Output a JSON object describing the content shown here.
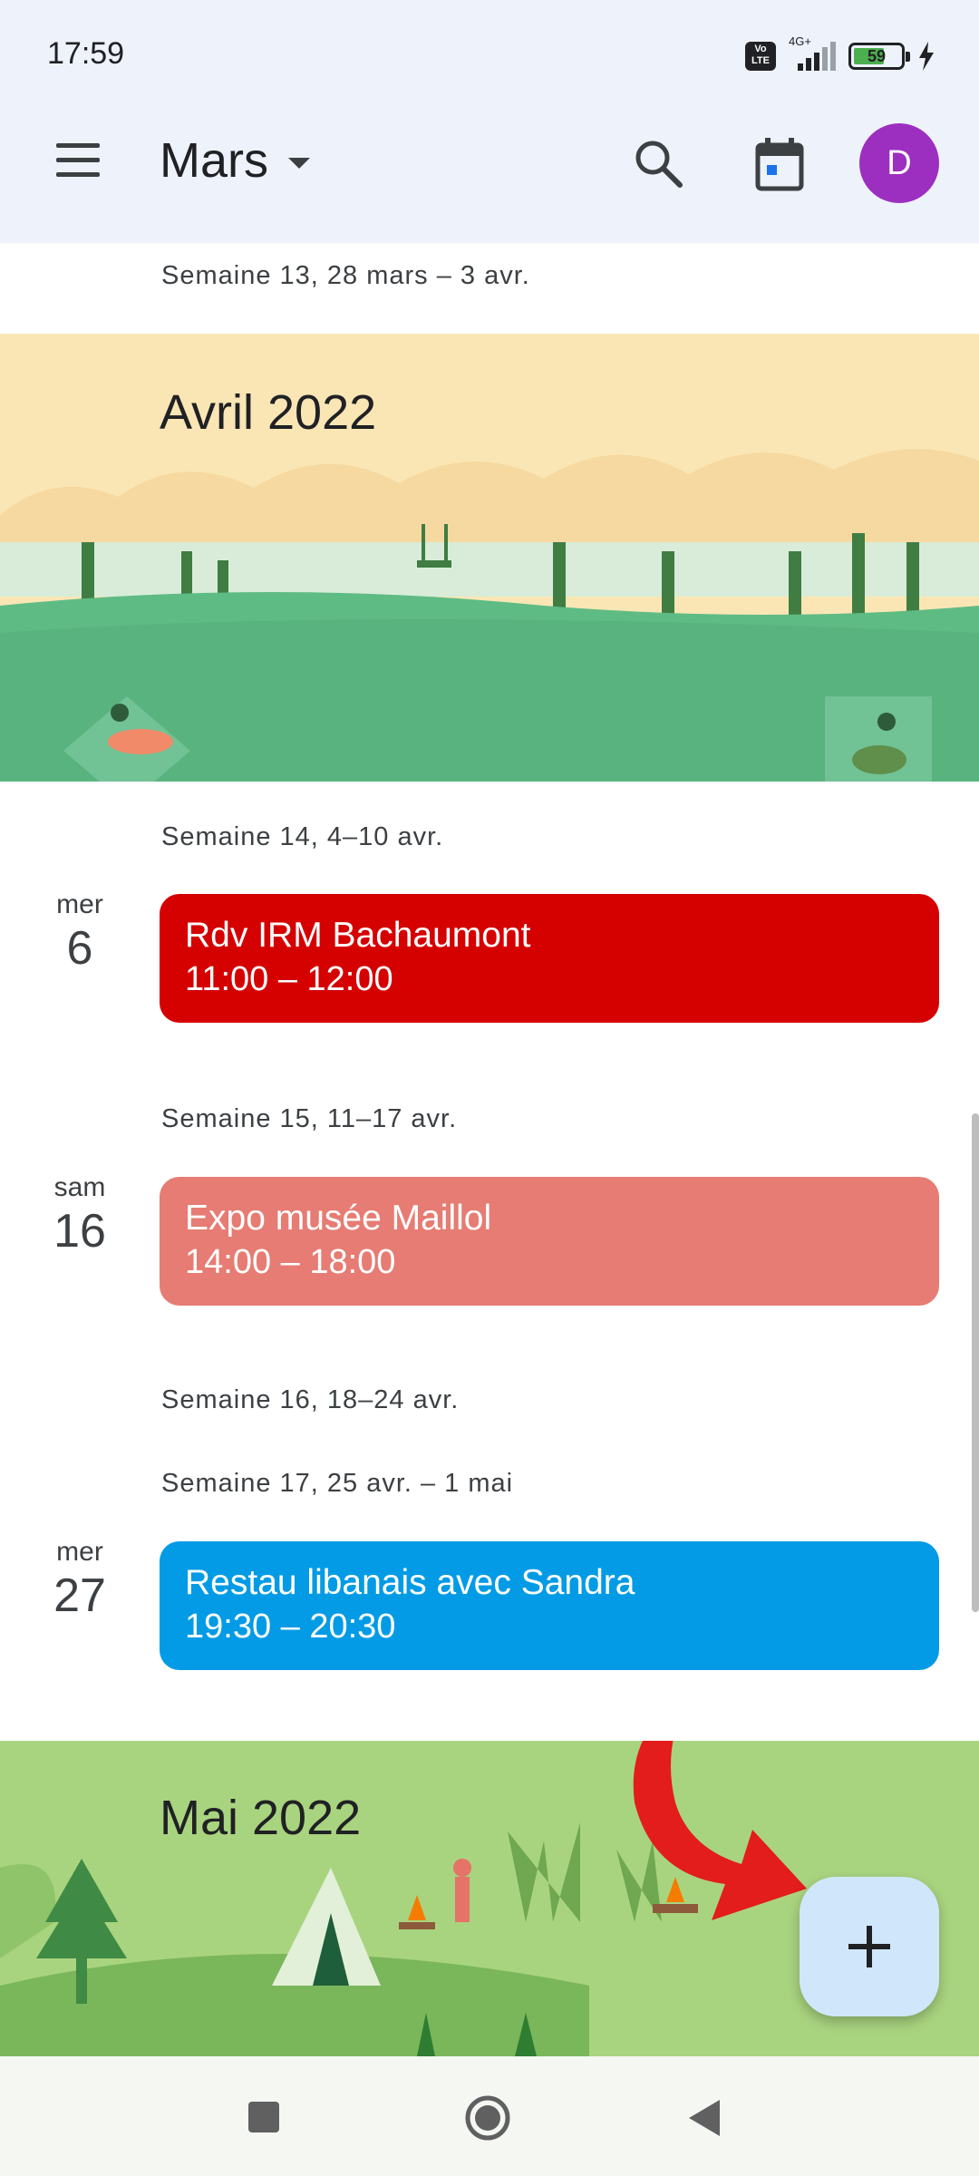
{
  "status_bar": {
    "time": "17:59",
    "network": "4G+",
    "volte": "Vo LTE",
    "battery": "59"
  },
  "app_bar": {
    "month": "Mars",
    "avatar_letter": "D"
  },
  "weeks": [
    "Semaine 13, 28 mars – 3 avr.",
    "Semaine 14, 4–10 avr.",
    "Semaine 15, 11–17 avr.",
    "Semaine 16, 18–24 avr.",
    "Semaine 17, 25 avr. – 1 mai"
  ],
  "months": [
    "Avril 2022",
    "Mai 2022"
  ],
  "events": [
    {
      "weekday": "mer",
      "day": "6",
      "title": "Rdv IRM Bachaumont",
      "time": "11:00 – 12:00",
      "color": "#d50000"
    },
    {
      "weekday": "sam",
      "day": "16",
      "title": "Expo musée Maillol",
      "time": "14:00 – 18:00",
      "color": "#e67c73"
    },
    {
      "weekday": "mer",
      "day": "27",
      "title": "Restau libanais avec Sandra",
      "time": "19:30 – 20:30",
      "color": "#039be5"
    }
  ],
  "fab": {
    "label": "+"
  },
  "colors": {
    "accent": "#9c2fc0",
    "fab_bg": "#d0e7fb",
    "app_bar_bg": "#eef2fb"
  },
  "icons": [
    "menu-icon",
    "search-icon",
    "calendar-today-icon",
    "add-icon",
    "red-arrow-annotation",
    "nav-recents-icon",
    "nav-home-icon",
    "nav-back-icon"
  ]
}
